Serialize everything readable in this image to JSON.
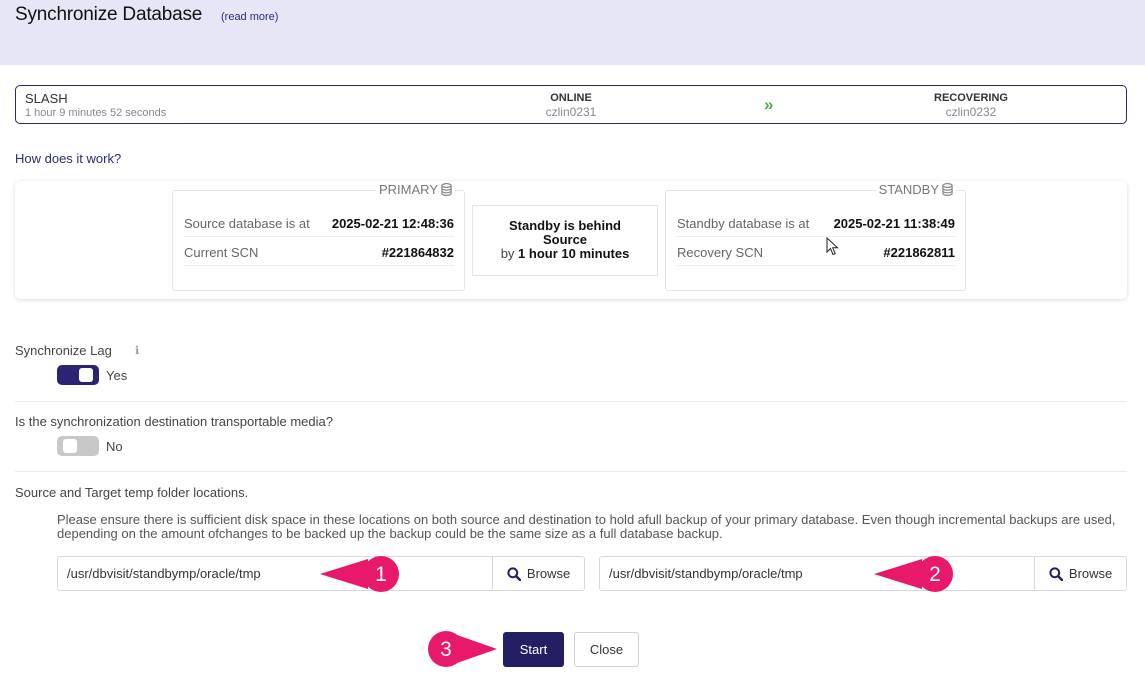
{
  "header": {
    "title": "Synchronize Database",
    "read_more": "(read more)"
  },
  "status": {
    "db_name": "SLASH",
    "uptime": "1 hour 9 minutes 52 seconds",
    "primary_state": "ONLINE",
    "primary_host": "czlin0231",
    "standby_state": "RECOVERING",
    "standby_host": "czlin0232"
  },
  "how_link": "How does it work?",
  "primary": {
    "legend": "PRIMARY",
    "source_label": "Source database is at",
    "source_value": "2025-02-21 12:48:36",
    "scn_label": "Current SCN",
    "scn_value": "#221864832"
  },
  "lag": {
    "line1": "Standby is behind",
    "line2": "Source",
    "by": "by",
    "amount": "1 hour 10 minutes"
  },
  "standby": {
    "legend": "STANDBY",
    "standby_label": "Standby database is at",
    "standby_value": "2025-02-21 11:38:49",
    "scn_label": "Recovery SCN",
    "scn_value": "#221862811"
  },
  "sync_lag": {
    "label": "Synchronize Lag",
    "value": "Yes",
    "enabled": true
  },
  "transport": {
    "label": "Is the synchronization destination transportable media?",
    "value": "No",
    "enabled": false
  },
  "temp": {
    "label": "Source and Target temp folder locations.",
    "note": "Please ensure there is sufficient disk space in these locations on both source and destination to hold afull backup of your primary database. Even though incremental backups are used, depending on the amount ofchanges to be backed up the backup could be the same size as a full database backup.",
    "source_path": "/usr/dbvisit/standbymp/oracle/tmp",
    "target_path": "/usr/dbvisit/standbymp/oracle/tmp",
    "browse_label": "Browse"
  },
  "callouts": [
    "1",
    "2",
    "3"
  ],
  "buttons": {
    "start": "Start",
    "close": "Close"
  },
  "colors": {
    "accent": "#241f63",
    "callout": "#e8196b",
    "header_bg": "#e6e6f7",
    "online_arrow": "#4caf50"
  }
}
